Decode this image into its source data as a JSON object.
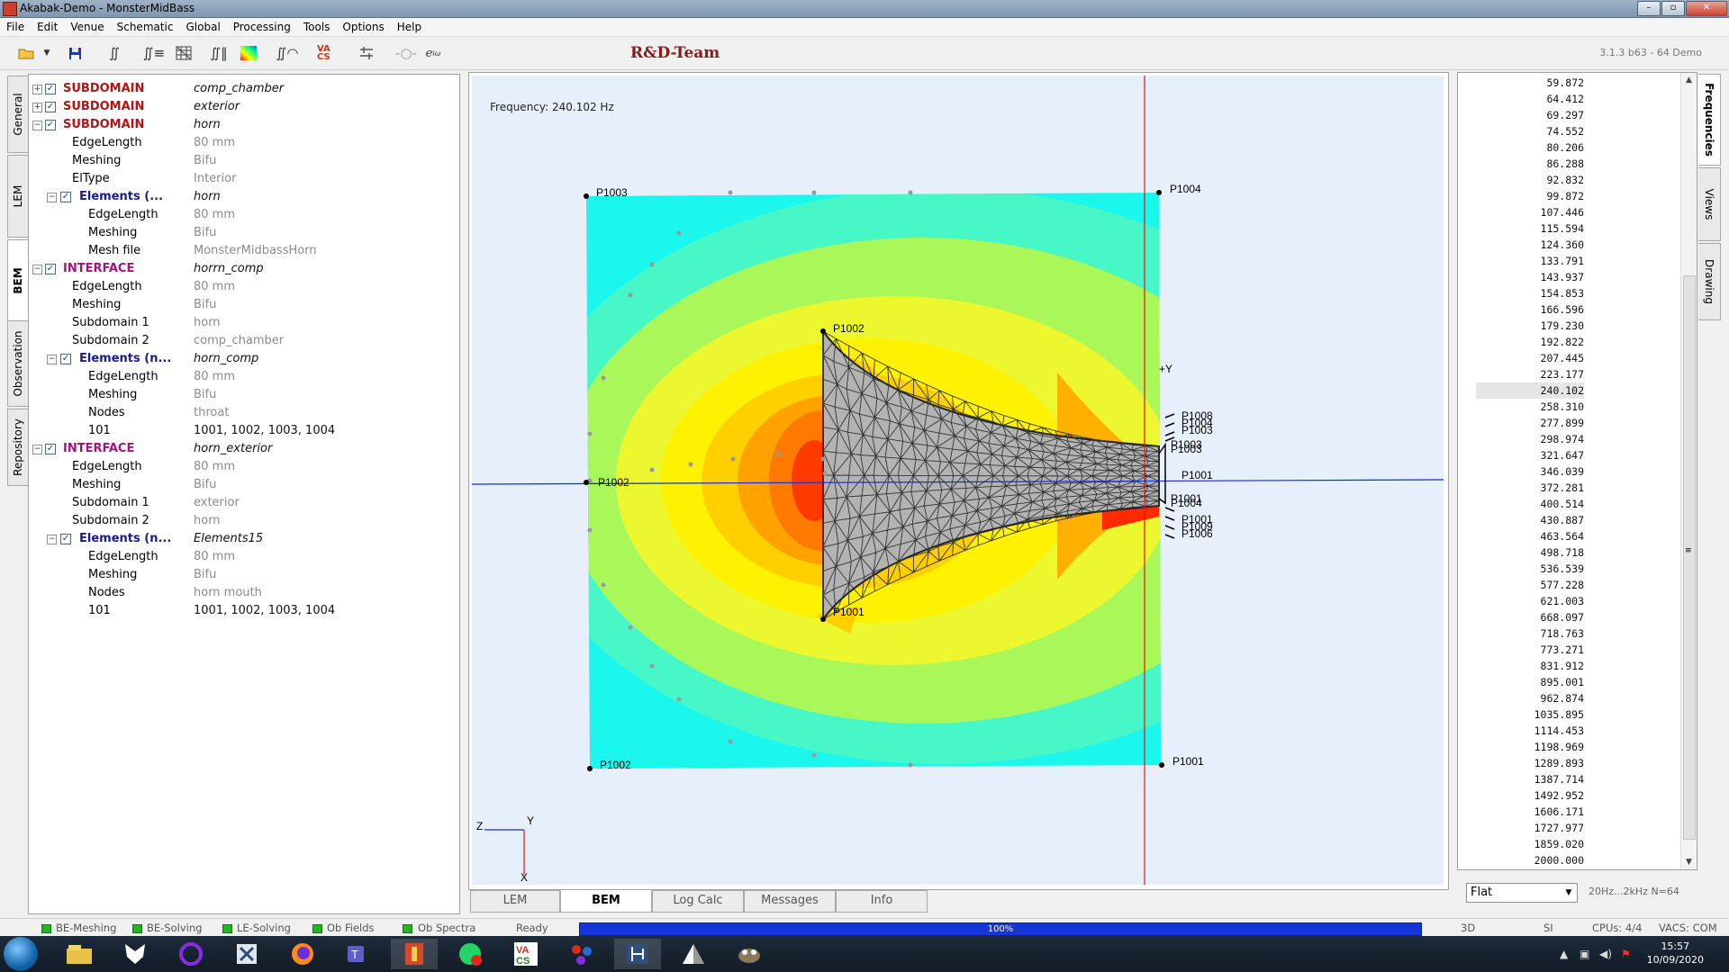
{
  "window": {
    "title": "Akabak-Demo - MonsterMidBass",
    "buttons": [
      "–",
      "▫",
      "✕"
    ]
  },
  "menu": [
    "File",
    "Edit",
    "Venue",
    "Schematic",
    "Global",
    "Processing",
    "Tools",
    "Options",
    "Help"
  ],
  "toolbar": {
    "team_label": "R&D-Team",
    "version": "3.1.3 b63 - 64 Demo",
    "eiw_symbol": "e",
    "eiw_sup": "iω",
    "vacs_label": "VA CS"
  },
  "left_tabs": [
    "General",
    "LEM",
    "BEM",
    "Observation",
    "Repository"
  ],
  "tree": [
    {
      "level": 0,
      "expand": "+",
      "check": true,
      "key": "SUBDOMAIN",
      "kind": "sub",
      "value": "comp_chamber",
      "vstyle": "it"
    },
    {
      "level": 0,
      "expand": "+",
      "check": true,
      "key": "SUBDOMAIN",
      "kind": "sub",
      "value": "exterior",
      "vstyle": "it"
    },
    {
      "level": 0,
      "expand": "−",
      "check": true,
      "key": "SUBDOMAIN",
      "kind": "sub",
      "value": "horn",
      "vstyle": "it"
    },
    {
      "level": 1,
      "key": "EdgeLength",
      "value": "80 mm",
      "vstyle": "gr"
    },
    {
      "level": 1,
      "key": "Meshing",
      "value": "Bifu",
      "vstyle": "gr"
    },
    {
      "level": 1,
      "key": "ElType",
      "value": "Interior",
      "vstyle": "gr"
    },
    {
      "level": 1,
      "expand": "−",
      "check": true,
      "key": "Elements (...",
      "kind": "elem",
      "value": "horn",
      "vstyle": "it"
    },
    {
      "level": 2,
      "key": "EdgeLength",
      "value": "80 mm",
      "vstyle": "gr"
    },
    {
      "level": 2,
      "key": "Meshing",
      "value": "Bifu",
      "vstyle": "gr"
    },
    {
      "level": 2,
      "key": "Mesh file",
      "value": "MonsterMidbassHorn",
      "vstyle": "gr"
    },
    {
      "level": 0,
      "expand": "−",
      "check": true,
      "key": "INTERFACE",
      "kind": "intf",
      "value": "horrn_comp",
      "vstyle": "it"
    },
    {
      "level": 1,
      "key": "EdgeLength",
      "value": "80 mm",
      "vstyle": "gr"
    },
    {
      "level": 1,
      "key": "Meshing",
      "value": "Bifu",
      "vstyle": "gr"
    },
    {
      "level": 1,
      "key": "Subdomain 1",
      "value": "horn",
      "vstyle": "gr"
    },
    {
      "level": 1,
      "key": "Subdomain 2",
      "value": "comp_chamber",
      "vstyle": "gr"
    },
    {
      "level": 1,
      "expand": "−",
      "check": true,
      "key": "Elements (n...",
      "kind": "elem",
      "value": "horn_comp",
      "vstyle": "it"
    },
    {
      "level": 2,
      "key": "EdgeLength",
      "value": "80 mm",
      "vstyle": "gr"
    },
    {
      "level": 2,
      "key": "Meshing",
      "value": "Bifu",
      "vstyle": "gr"
    },
    {
      "level": 2,
      "key": "Nodes",
      "value": "throat",
      "vstyle": "gr"
    },
    {
      "level": 2,
      "key": "101",
      "value": "1001, 1002, 1003, 1004",
      "vstyle": "bk"
    },
    {
      "level": 0,
      "expand": "−",
      "check": true,
      "key": "INTERFACE",
      "kind": "intf",
      "value": "horn_exterior",
      "vstyle": "it"
    },
    {
      "level": 1,
      "key": "EdgeLength",
      "value": "80 mm",
      "vstyle": "gr"
    },
    {
      "level": 1,
      "key": "Meshing",
      "value": "Bifu",
      "vstyle": "gr"
    },
    {
      "level": 1,
      "key": "Subdomain 1",
      "value": "exterior",
      "vstyle": "gr"
    },
    {
      "level": 1,
      "key": "Subdomain 2",
      "value": "horn",
      "vstyle": "gr"
    },
    {
      "level": 1,
      "expand": "−",
      "check": true,
      "key": "Elements (n...",
      "kind": "elem",
      "value": "Elements15",
      "vstyle": "it"
    },
    {
      "level": 2,
      "key": "EdgeLength",
      "value": "80 mm",
      "vstyle": "gr"
    },
    {
      "level": 2,
      "key": "Meshing",
      "value": "Bifu",
      "vstyle": "gr"
    },
    {
      "level": 2,
      "key": "Nodes",
      "value": "horn mouth",
      "vstyle": "gr"
    },
    {
      "level": 2,
      "key": "101",
      "value": "1001, 1002, 1003, 1004",
      "vstyle": "bk"
    }
  ],
  "plot": {
    "frequency_label": "Frequency: 240.102 Hz",
    "axis_labels": {
      "plus_y": "+Y",
      "z": "Z",
      "y": "Y",
      "x": "X"
    },
    "points": {
      "top_left": "P1003",
      "top_right": "P1004",
      "bottom_left": "P1002",
      "bottom_right": "P1001",
      "left_mid": "P1002",
      "horn_top": "P1002",
      "horn_bottom": "P1001",
      "throat_mid": "P1001",
      "throat_upper": [
        "P1008",
        "P1004",
        "P1003",
        "P1003",
        "P1003"
      ],
      "throat_lower": [
        "P1001",
        "P1004",
        "P1001",
        "P1009",
        "P1006"
      ]
    },
    "colors": {
      "background": "#e7effa",
      "red_axis": "#e81010",
      "blue_axis": "#1a2bcf",
      "mesh": "#a9a9a9"
    }
  },
  "bottom_tabs": [
    "LEM",
    "BEM",
    "Log Calc",
    "Messages",
    "Info"
  ],
  "bottom_tab_active": "BEM",
  "frequencies": [
    "59.872",
    "64.412",
    "69.297",
    "74.552",
    "80.206",
    "86.288",
    "92.832",
    "99.872",
    "107.446",
    "115.594",
    "124.360",
    "133.791",
    "143.937",
    "154.853",
    "166.596",
    "179.230",
    "192.822",
    "207.445",
    "223.177",
    "240.102",
    "258.310",
    "277.899",
    "298.974",
    "321.647",
    "346.039",
    "372.281",
    "400.514",
    "430.887",
    "463.564",
    "498.718",
    "536.539",
    "577.228",
    "621.003",
    "668.097",
    "718.763",
    "773.271",
    "831.912",
    "895.001",
    "962.874",
    "1035.895",
    "1114.453",
    "1198.969",
    "1289.893",
    "1387.714",
    "1492.952",
    "1606.171",
    "1727.977",
    "1859.020",
    "2000.000"
  ],
  "selected_frequency": "240.102",
  "freq_scroll_mid": "≡",
  "weighting": {
    "selected": "Flat"
  },
  "range_info": "20Hz...2kHz  N=64",
  "right_tabs": [
    "Frequencies",
    "Views",
    "Drawing"
  ],
  "status": {
    "items": [
      "BE-Meshing",
      "BE-Solving",
      "LE-Solving",
      "Ob Fields",
      "Ob Spectra"
    ],
    "ready": "Ready",
    "progress": "100%",
    "progress_fraction": 1.0,
    "mode": "3D",
    "units": "SI",
    "cpus": "CPUs: 4/4",
    "vacs": "VACS: COM"
  },
  "clock": {
    "time": "15:57",
    "date": "10/09/2020"
  }
}
